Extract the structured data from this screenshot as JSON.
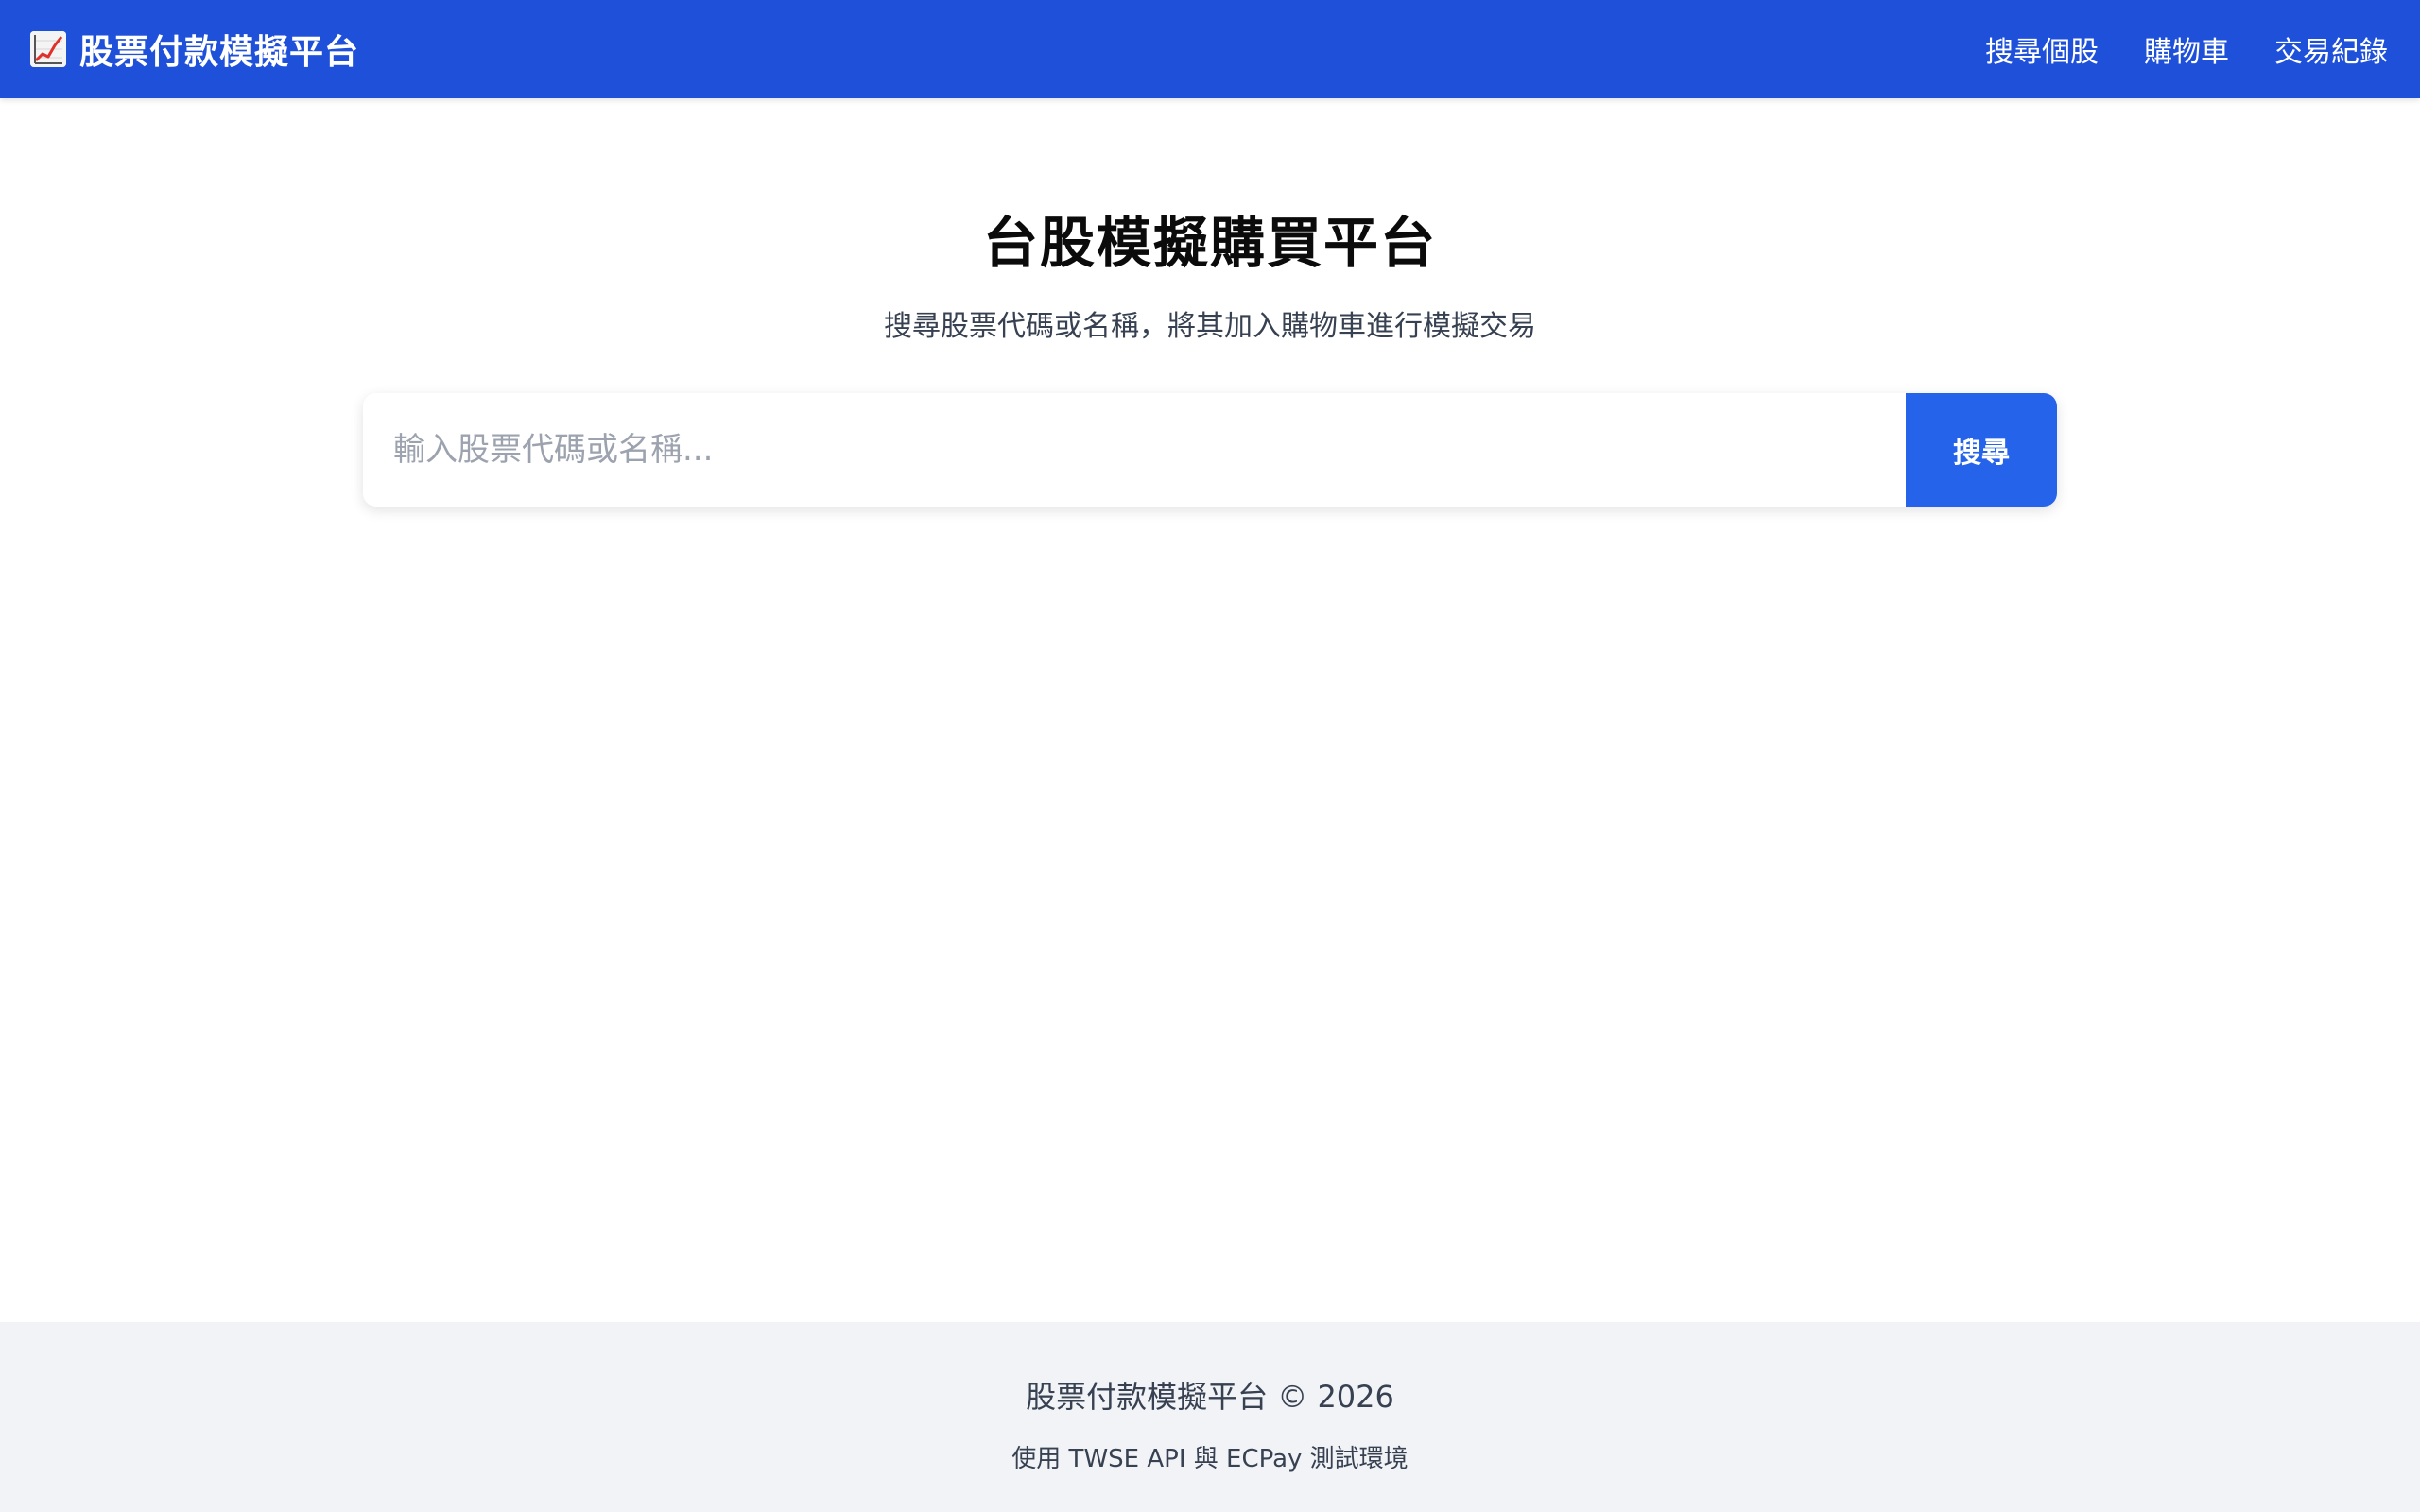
{
  "header": {
    "brand_icon": "chart-increasing-icon",
    "brand_title": "股票付款模擬平台",
    "nav": [
      "搜尋個股",
      "購物車",
      "交易紀錄"
    ]
  },
  "hero": {
    "title": "台股模擬購買平台",
    "subtitle": "搜尋股票代碼或名稱，將其加入購物車進行模擬交易"
  },
  "search": {
    "placeholder": "輸入股票代碼或名稱...",
    "value": "",
    "button_label": "搜尋"
  },
  "footer": {
    "copyright": "股票付款模擬平台 © 2026",
    "note": "使用 TWSE API 與 ECPay 測試環境"
  },
  "colors": {
    "navbar": "#1f50da",
    "button": "#2563eb",
    "footer_bg": "#f1f3f6"
  }
}
